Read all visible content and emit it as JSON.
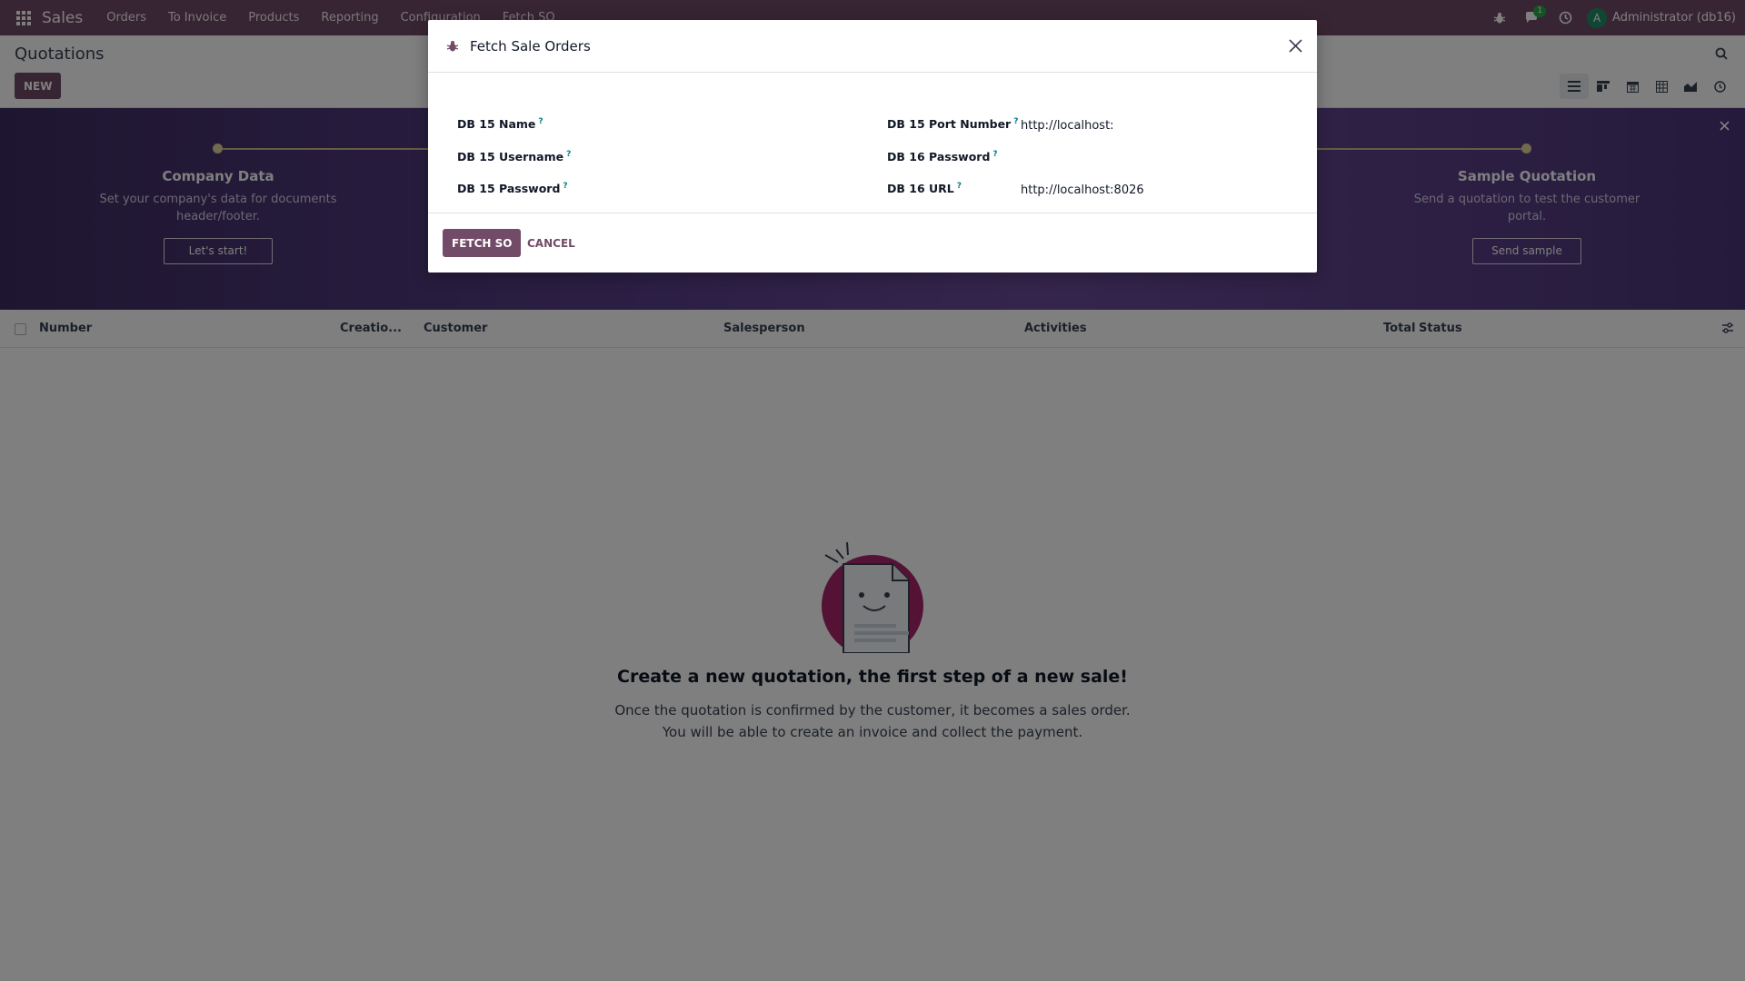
{
  "navbar": {
    "brand": "Sales",
    "menu": [
      "Orders",
      "To Invoice",
      "Products",
      "Reporting",
      "Configuration",
      "Fetch SO"
    ],
    "messages_badge": "1",
    "user_initial": "A",
    "user_name": "Administrator (db16)"
  },
  "control_panel": {
    "title": "Quotations",
    "new_label": "NEW"
  },
  "banner": {
    "steps": [
      {
        "title": "Company Data",
        "desc_line1": "Set your company's data for documents",
        "desc_line2": "header/footer.",
        "button": "Let's start!"
      },
      {
        "title": "Sample Quotation",
        "desc_line1": "Send a quotation to test the customer",
        "desc_line2": "portal.",
        "button": "Send sample"
      }
    ]
  },
  "list": {
    "columns": [
      "Number",
      "Creatio...",
      "Customer",
      "Salesperson",
      "Activities",
      "Total",
      "Status"
    ]
  },
  "empty_state": {
    "title": "Create a new quotation, the first step of a new sale!",
    "line1": "Once the quotation is confirmed by the customer, it becomes a sales order.",
    "line2": "You will be able to create an invoice and collect the payment."
  },
  "modal": {
    "title": "Fetch Sale Orders",
    "help_marker": "?",
    "fields": {
      "db15_name_label": "DB 15 Name",
      "db15_username_label": "DB 15 Username",
      "db15_password_label": "DB 15 Password",
      "db15_port_label": "DB 15 Port Number",
      "db15_port_value": "http://localhost:",
      "db16_password_label": "DB 16 Password",
      "db16_url_label": "DB 16 URL",
      "db16_url_value": "http://localhost:8026"
    },
    "primary_button": "FETCH SO",
    "cancel_button": "CANCEL"
  },
  "colors": {
    "brand": "#714b67",
    "help_marker": "#017e84",
    "badge": "#28a745"
  }
}
